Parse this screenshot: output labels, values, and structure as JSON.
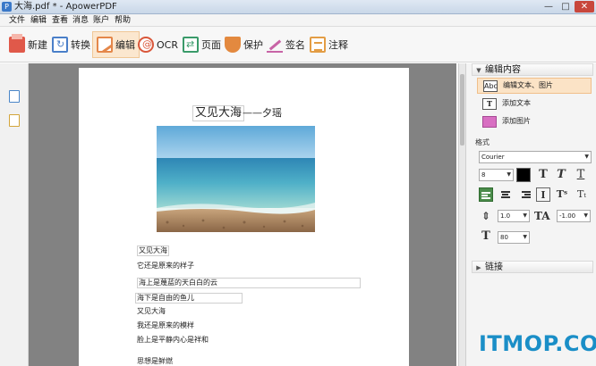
{
  "window": {
    "title": "大海.pdf * - ApowerPDF",
    "app_icon": "P",
    "controls": {
      "minimize": "—",
      "maximize": "□",
      "close": "✕"
    }
  },
  "menubar": [
    "文件",
    "编辑",
    "查看",
    "消息",
    "账户",
    "帮助"
  ],
  "toolbar": [
    {
      "label": "新建",
      "icon": "new-icon"
    },
    {
      "label": "转换",
      "icon": "convert-icon"
    },
    {
      "label": "编辑",
      "icon": "edit-icon",
      "active": true
    },
    {
      "label": "OCR",
      "icon": "ocr-icon"
    },
    {
      "label": "页面",
      "icon": "page-icon"
    },
    {
      "label": "保护",
      "icon": "protect-icon"
    },
    {
      "label": "签名",
      "icon": "sign-icon"
    },
    {
      "label": "注释",
      "icon": "note-icon"
    }
  ],
  "document": {
    "title": "又见大海",
    "subtitle": "——夕瑶",
    "lines": [
      "又见大海",
      "它还是原来的样子",
      "海上是蔑蓝的天白白的云",
      "海下是自由的鱼儿",
      "又见大海",
      "我还是原来的模样",
      "脸上是平静内心是祥和",
      "思想是鲜燃"
    ]
  },
  "rightpanel": {
    "edit_section": "编辑内容",
    "mode_items": [
      {
        "label": "编辑文本、图片",
        "icon": "edit-text-image-icon",
        "glyph": "Abc",
        "selected": true
      },
      {
        "label": "添加文本",
        "icon": "add-text-icon",
        "glyph": "T"
      },
      {
        "label": "添加图片",
        "icon": "add-image-icon",
        "glyph": ""
      }
    ],
    "format_label": "格式",
    "font_value": "Courier",
    "size_value": "8",
    "line_spacing_value": "1.0",
    "char_spacing_value": "-1.00",
    "scale_value": "80",
    "link_section": "链接"
  },
  "watermark": "ITMOP.COM",
  "colors": {
    "accent": "#fbe7cf",
    "watermark": "#1a8ec7",
    "selected_align": "#4a8c4a"
  }
}
